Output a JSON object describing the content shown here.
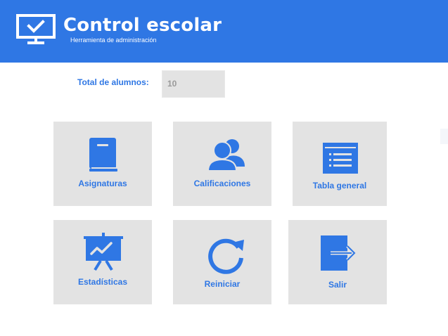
{
  "header": {
    "title": "Control escolar",
    "subtitle": "Herramienta de administración",
    "icon": "monitor-check-icon",
    "color": "#2f77e4"
  },
  "total": {
    "label": "Total de alumnos:",
    "value": "10"
  },
  "tiles": [
    {
      "label": "Asignaturas",
      "icon": "book-icon"
    },
    {
      "label": "Calificaciones",
      "icon": "users-icon"
    },
    {
      "label": "Tabla general",
      "icon": "table-list-icon"
    },
    {
      "label": "Estadísticas",
      "icon": "presentation-chart-icon"
    },
    {
      "label": "Reiniciar",
      "icon": "refresh-icon"
    },
    {
      "label": "Salir",
      "icon": "exit-icon"
    }
  ],
  "colors": {
    "accent": "#2f77e4",
    "tile_bg": "#e3e3e3",
    "field_text": "#9a9a9a"
  }
}
